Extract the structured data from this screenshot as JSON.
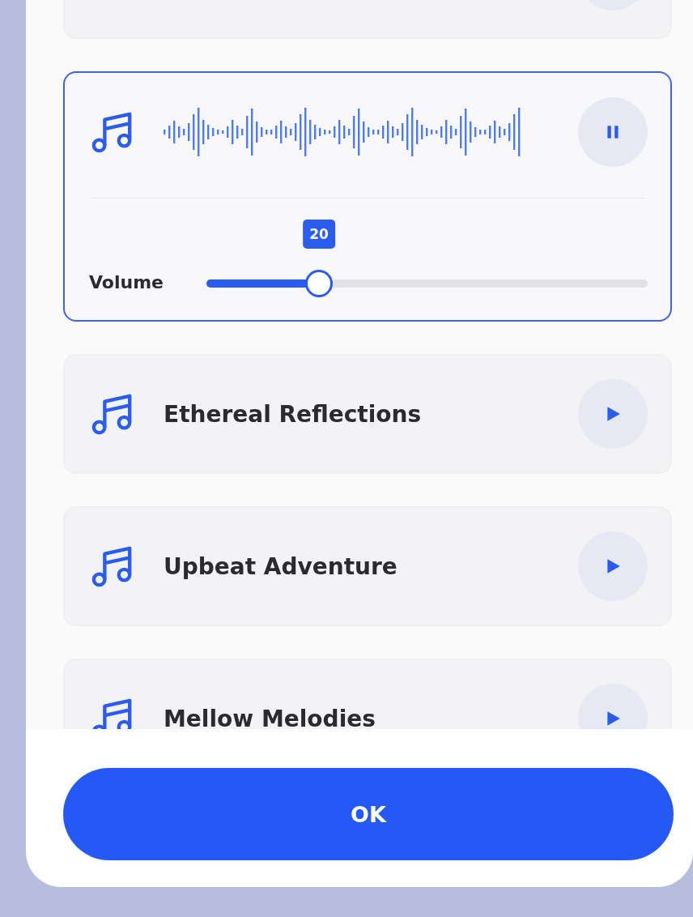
{
  "tracks": [
    {
      "kind": "clipped",
      "selected": false
    },
    {
      "kind": "track",
      "selected": true,
      "playing": true,
      "volume": {
        "label": "Volume",
        "level": 0.255,
        "reading": "20"
      }
    },
    {
      "kind": "track",
      "title": "Ethereal Reflections",
      "selected": false,
      "playing": false
    },
    {
      "kind": "track",
      "title": "Upbeat Adventure",
      "selected": false,
      "playing": false
    },
    {
      "kind": "track",
      "title": "Mellow Melodies",
      "selected": false,
      "playing": false
    }
  ],
  "ok_button": "OK"
}
